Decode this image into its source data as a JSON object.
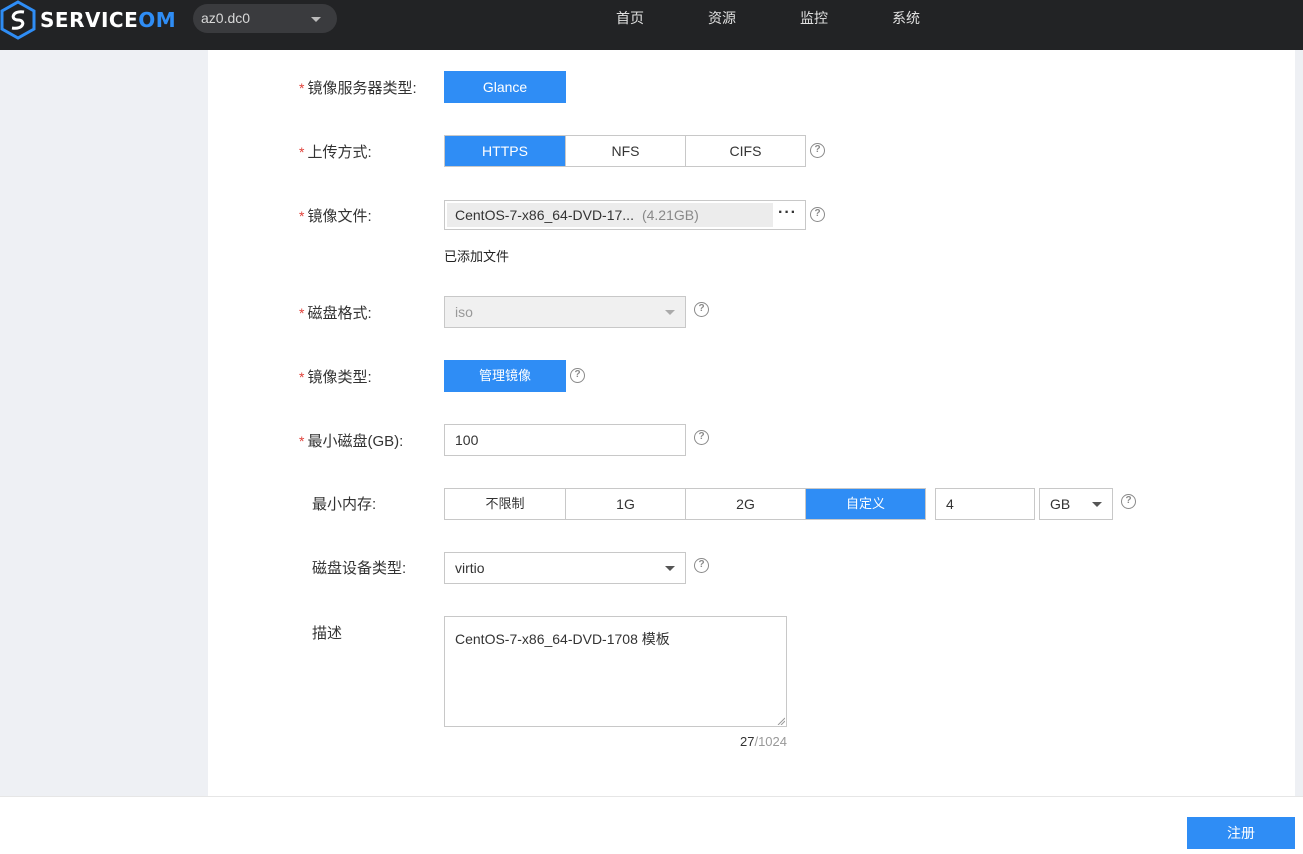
{
  "header": {
    "logo": {
      "prefix": "SERVICE",
      "suffix": "OM"
    },
    "region": "az0.dc0",
    "nav": [
      "首页",
      "资源",
      "监控",
      "系统"
    ]
  },
  "form": {
    "server_type": {
      "label": "镜像服务器类型:",
      "value": "Glance"
    },
    "upload": {
      "label": "上传方式:",
      "options": [
        "HTTPS",
        "NFS",
        "CIFS"
      ],
      "selected": "HTTPS"
    },
    "file": {
      "label": "镜像文件:",
      "name": "CentOS-7-x86_64-DVD-17...",
      "size": "(4.21GB)",
      "more": "···",
      "status": "已添加文件"
    },
    "disk_format": {
      "label": "磁盘格式:",
      "value": "iso"
    },
    "image_type": {
      "label": "镜像类型:",
      "value": "管理镜像"
    },
    "min_disk": {
      "label": "最小磁盘(GB):",
      "value": "100"
    },
    "min_mem": {
      "label": "最小内存:",
      "options": [
        "不限制",
        "1G",
        "2G",
        "自定义"
      ],
      "selected": "自定义",
      "custom_value": "4",
      "unit": "GB"
    },
    "disk_device": {
      "label": "磁盘设备类型:",
      "value": "virtio"
    },
    "description": {
      "label": "描述",
      "value": "CentOS-7-x86_64-DVD-1708 模板",
      "count": "27",
      "max": "/1024"
    }
  },
  "footer": {
    "register": "注册"
  },
  "colors": {
    "accent": "#2f8df5",
    "topbar": "#222325",
    "required": "#e0413a"
  }
}
